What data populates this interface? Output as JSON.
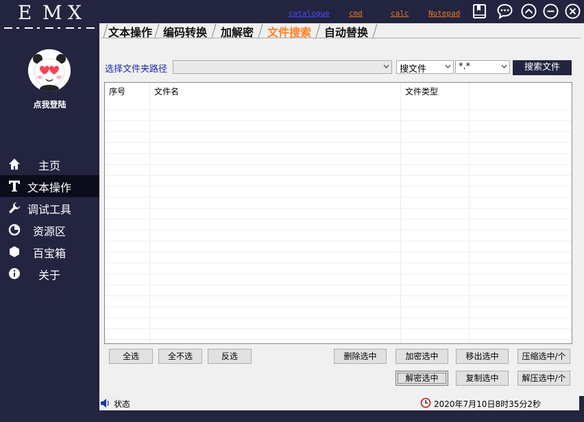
{
  "app": {
    "logo_letters": [
      "E",
      "M",
      "X"
    ],
    "login_label": "点我登陆"
  },
  "sidebar": {
    "items": [
      {
        "label": "主页",
        "icon": "home-icon"
      },
      {
        "label": "文本操作",
        "icon": "text-icon",
        "active": true
      },
      {
        "label": "调试工具",
        "icon": "wrench-icon"
      },
      {
        "label": "资源区",
        "icon": "pie-chart-icon"
      },
      {
        "label": "百宝箱",
        "icon": "hexagon-icon"
      },
      {
        "label": "关于",
        "icon": "info-icon"
      }
    ]
  },
  "toplinks": [
    "catalogue",
    "cmd",
    "calc",
    "Notepad"
  ],
  "toplink_colors": {
    "catalogue": "#4a4aff",
    "cmd": "#e87a1e",
    "calc": "#e87a1e",
    "Notepad": "#e87a1e"
  },
  "tabs": [
    "文本操作",
    "编码转换",
    "加解密",
    "文件搜索",
    "自动替换"
  ],
  "active_tab": "文件搜索",
  "search": {
    "path_label": "选择文件夹路径",
    "path_value": "",
    "mode_value": "搜文件",
    "filter_value": "*.*",
    "search_button": "搜索文件"
  },
  "table": {
    "columns": [
      "序号",
      "文件名",
      "文件类型"
    ],
    "rows": []
  },
  "buttons": {
    "select_all": "全选",
    "select_none": "全不选",
    "invert": "反选",
    "delete": "删除选中",
    "encrypt": "加密选中",
    "move_out": "移出选中",
    "compress": "压缩选中/个",
    "decrypt": "解密选中",
    "copy": "复制选中",
    "decompress": "解压选中/个"
  },
  "status": {
    "label": "状态",
    "datetime": "2020年7月10日8时35分2秒"
  },
  "colors": {
    "sidebar_bg": "#23243f",
    "active_nav_bg": "#0b0c1a",
    "active_tab": "#ff7f1f",
    "path_label": "#1a2aa5"
  }
}
